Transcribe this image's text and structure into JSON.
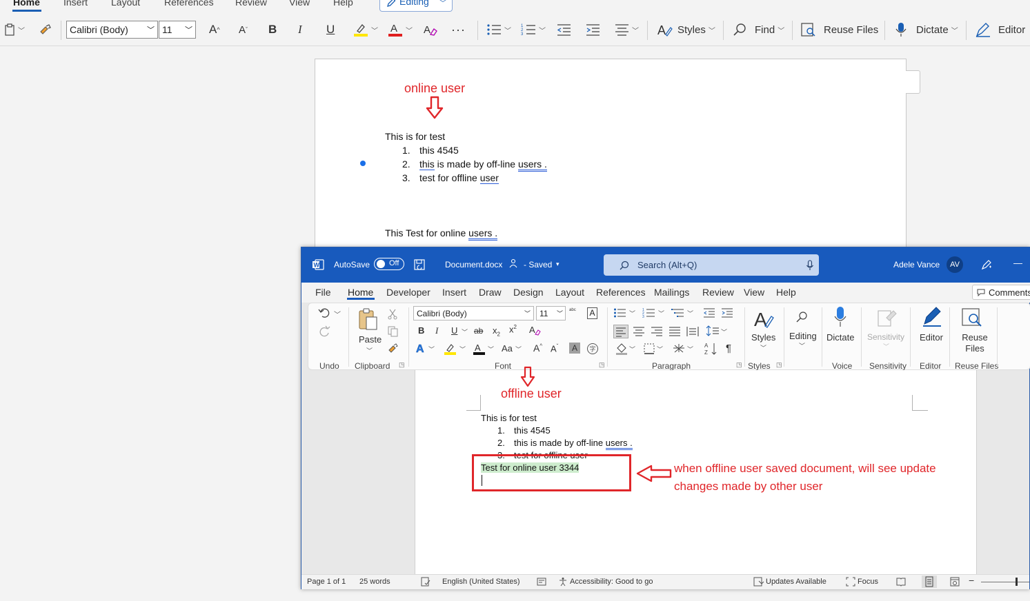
{
  "web_ribbon": {
    "tabs": [
      "Home",
      "Insert",
      "Layout",
      "References",
      "Review",
      "View",
      "Help"
    ],
    "editing_mode": "Editing",
    "font_name": "Calibri (Body)",
    "font_size": "11",
    "bold": "B",
    "italic": "I",
    "underline": "U",
    "more": "···",
    "styles": "Styles",
    "find": "Find",
    "reuse_files": "Reuse Files",
    "dictate": "Dictate",
    "editor": "Editor",
    "accent_color": "#1a5fb4"
  },
  "web_doc": {
    "note": "online user",
    "line1": "This is for test",
    "list": [
      {
        "num": "1.",
        "text": "this 4545"
      },
      {
        "num": "2.",
        "pre": "this",
        "mid": " is made by off-line ",
        "post": "users ."
      },
      {
        "num": "3.",
        "pre": "test for offline ",
        "post": "user"
      }
    ],
    "line2_pre": "This Test for online ",
    "line2_post": "users ."
  },
  "desktop": {
    "autosave_label": "AutoSave",
    "autosave_state": "Off",
    "doc_name": "Document.docx",
    "saved_state": "- Saved",
    "search_placeholder": "Search (Alt+Q)",
    "user_name": "Adele Vance",
    "user_initials": "AV",
    "minimize": "—",
    "title_bar_color": "#185abd",
    "tabs": [
      "File",
      "Home",
      "Developer",
      "Insert",
      "Draw",
      "Design",
      "Layout",
      "References",
      "Mailings",
      "Review",
      "View",
      "Help"
    ],
    "comments_button": "Comments",
    "ribbon": {
      "paste": "Paste",
      "font_name": "Calibri (Body)",
      "font_size": "11",
      "bold": "B",
      "italic": "I",
      "underline": "U",
      "strike": "ab",
      "subscript": "x",
      "superscript": "x",
      "change_case": "Aa",
      "styles": "Styles",
      "editing": "Editing",
      "dictate": "Dictate",
      "sensitivity": "Sensitivity",
      "editor": "Editor",
      "reuse_files": "Reuse Files",
      "groups": {
        "undo": "Undo",
        "clipboard": "Clipboard",
        "font": "Font",
        "paragraph": "Paragraph",
        "styles": "Styles",
        "voice": "Voice",
        "sensitivity": "Sensitivity",
        "editor": "Editor",
        "reuse_files": "Reuse Files"
      }
    },
    "doc": {
      "note": "offline user",
      "line1": "This is for test",
      "list": [
        {
          "num": "1.",
          "text": "this 4545"
        },
        {
          "num": "2.",
          "pre": "this is made by off-line ",
          "post": "users ."
        },
        {
          "num": "3.",
          "text": "test for offline user"
        }
      ],
      "added_line": "Test for online user 3344",
      "callout": "when offline user saved document, will see update changes made by other user"
    },
    "status": {
      "page": "Page 1 of 1",
      "words": "25 words",
      "language": "English (United States)",
      "accessibility": "Accessibility: Good to go",
      "updates": "Updates Available",
      "focus": "Focus"
    }
  }
}
